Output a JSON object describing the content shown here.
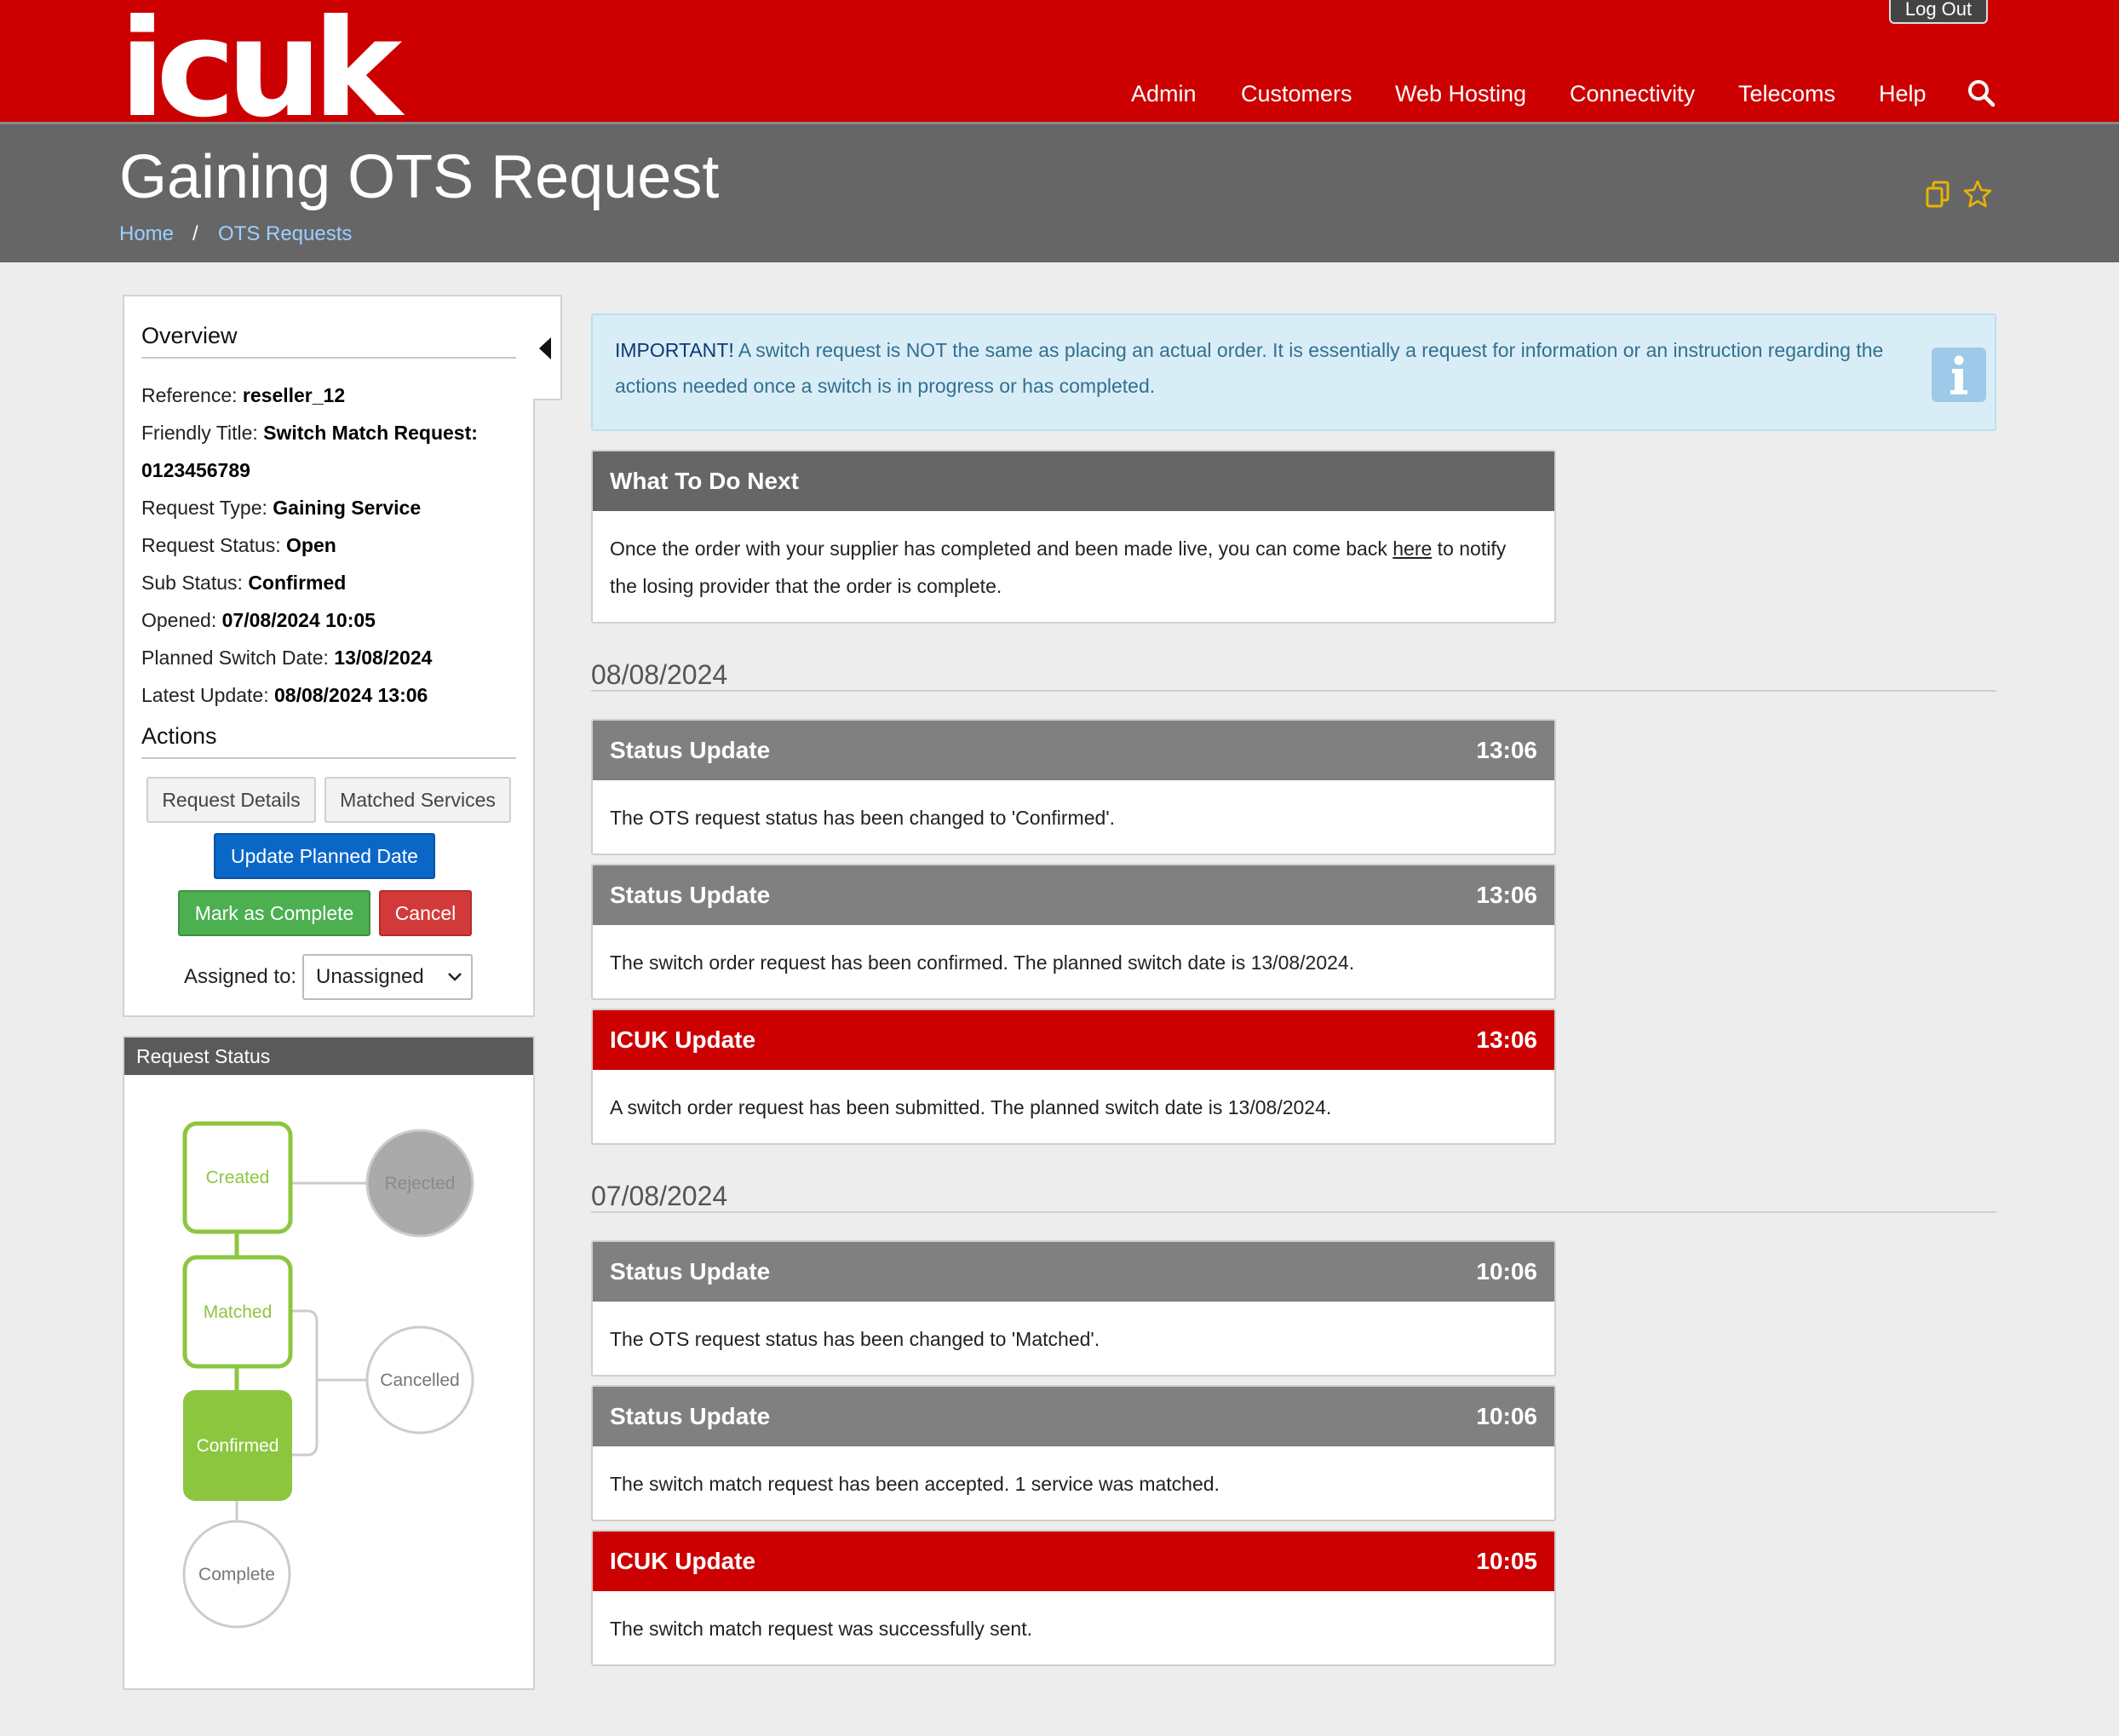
{
  "brand": {
    "logo_text": "icuk",
    "accent": "#cc0000"
  },
  "header": {
    "logout_label": "Log Out",
    "nav": [
      "Admin",
      "Customers",
      "Web Hosting",
      "Connectivity",
      "Telecoms",
      "Help"
    ],
    "search_icon": "search-icon"
  },
  "title_band": {
    "title": "Gaining OTS Request",
    "breadcrumb": [
      "Home",
      "OTS Requests"
    ],
    "breadcrumb_separator": "/",
    "icons": [
      "copy-icon",
      "star-icon"
    ]
  },
  "overview": {
    "heading": "Overview",
    "reference_label": "Reference:",
    "reference_value": "reseller_12",
    "friendly_title_label": "Friendly Title:",
    "friendly_title_value": "Switch Match Request:",
    "friendly_title_value_line2": "0123456789",
    "request_type_label": "Request Type:",
    "request_type_value": "Gaining Service",
    "request_status_label": "Request Status:",
    "request_status_value": "Open",
    "sub_status_label": "Sub Status:",
    "sub_status_value": "Confirmed",
    "opened_label": "Opened:",
    "opened_value": "07/08/2024 10:05",
    "planned_switch_date_label": "Planned Switch Date:",
    "planned_switch_date_value": "13/08/2024",
    "latest_update_label": "Latest Update:",
    "latest_update_value": "08/08/2024 13:06"
  },
  "actions": {
    "heading": "Actions",
    "request_details": "Request Details",
    "matched_services": "Matched Services",
    "update_planned_date": "Update Planned Date",
    "mark_as_complete": "Mark as Complete",
    "cancel": "Cancel",
    "assigned_to_label": "Assigned to:",
    "assigned_to_value": "Unassigned"
  },
  "request_status": {
    "heading": "Request Status",
    "stages": [
      "Created",
      "Rejected",
      "Matched",
      "Cancelled",
      "Confirmed",
      "Complete"
    ],
    "current_stage": "Confirmed",
    "colors": {
      "done": "#8cc63f",
      "inactive": "#cccccc",
      "rejected_fill": "#aaaaaa"
    }
  },
  "alert": {
    "strong": "IMPORTANT!",
    "text": " A switch request is NOT the same as placing an actual order. It is essentially a request for information or an instruction regarding the actions needed once a switch is in progress or has completed.",
    "icon": "info-icon"
  },
  "next_steps": {
    "title": "What To Do Next",
    "text_before": "Once the order with your supplier has completed and been made live, you can come back ",
    "link": "here",
    "text_after": " to notify the losing provider that the order is complete."
  },
  "timeline": [
    {
      "date": "08/08/2024",
      "entries": [
        {
          "title": "Status Update",
          "time": "13:06",
          "text": "The OTS request status has been changed to 'Confirmed'."
        },
        {
          "title": "Status Update",
          "time": "13:06",
          "text": "The switch order request has been confirmed. The planned switch date is 13/08/2024."
        },
        {
          "title": "ICUK Update",
          "time": "13:06",
          "text": "A switch order request has been submitted. The planned switch date is 13/08/2024."
        }
      ]
    },
    {
      "date": "07/08/2024",
      "entries": [
        {
          "title": "Status Update",
          "time": "10:06",
          "text": "The OTS request status has been changed to 'Matched'."
        },
        {
          "title": "Status Update",
          "time": "10:06",
          "text": "The switch match request has been accepted. 1 service was matched."
        },
        {
          "title": "ICUK Update",
          "time": "10:05",
          "text": "The switch match request was successfully sent."
        }
      ]
    }
  ]
}
